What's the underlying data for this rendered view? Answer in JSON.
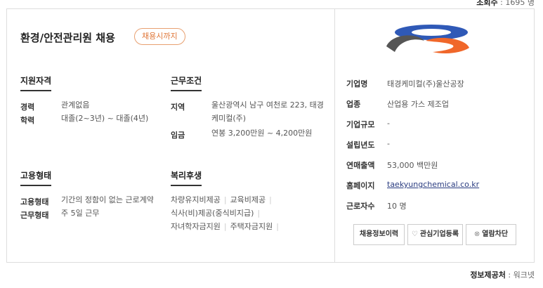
{
  "views": {
    "label": "조회수",
    "value": "1695 명"
  },
  "job": {
    "title": "환경/안전관리원 채용",
    "badge": "채용시까지"
  },
  "qualifications": {
    "heading": "지원자격",
    "career_label": "경력",
    "career_value": "관계없음",
    "education_label": "학력",
    "education_value": "대졸(2~3년) ~ 대졸(4년)"
  },
  "conditions": {
    "heading": "근무조건",
    "location_label": "지역",
    "location_value": "울산광역시 남구 여천로 223, 태경케미컬(주)",
    "salary_label": "임금",
    "salary_value": "연봉 3,200만원 ~ 4,200만원"
  },
  "employment": {
    "heading": "고용형태",
    "type_label": "고용형태",
    "type_value": "기간의 정함이 없는 근로계약",
    "work_label": "근무형태",
    "work_value": "주 5일 근무"
  },
  "benefits": {
    "heading": "복리후생",
    "items": [
      "차량유지비제공",
      "교육비제공",
      "식사(비)제공(중식비지급)",
      "자녀학자금지원",
      "주택자금지원"
    ]
  },
  "company": {
    "name_label": "기업명",
    "name_value": "태경케미컬(주)울산공장",
    "industry_label": "업종",
    "industry_value": "산업용 가스 제조업",
    "size_label": "기업규모",
    "size_value": "-",
    "founded_label": "설립년도",
    "founded_value": "-",
    "revenue_label": "연매출액",
    "revenue_value": "53,000 백만원",
    "homepage_label": "홈페이지",
    "homepage_value": "taekyungchemical.co.kr",
    "employees_label": "근로자수",
    "employees_value": "10 명",
    "logo_colors": {
      "dark": "#555555",
      "orange": "#f0672a",
      "blue": "#2f59b7"
    }
  },
  "buttons": {
    "history": "채용정보이력",
    "favorite": "관심기업등록",
    "block": "열람차단"
  },
  "icons": {
    "favorite": "heart-icon",
    "block": "block-icon"
  },
  "source": {
    "label": "정보제공처",
    "value": "워크넷"
  }
}
